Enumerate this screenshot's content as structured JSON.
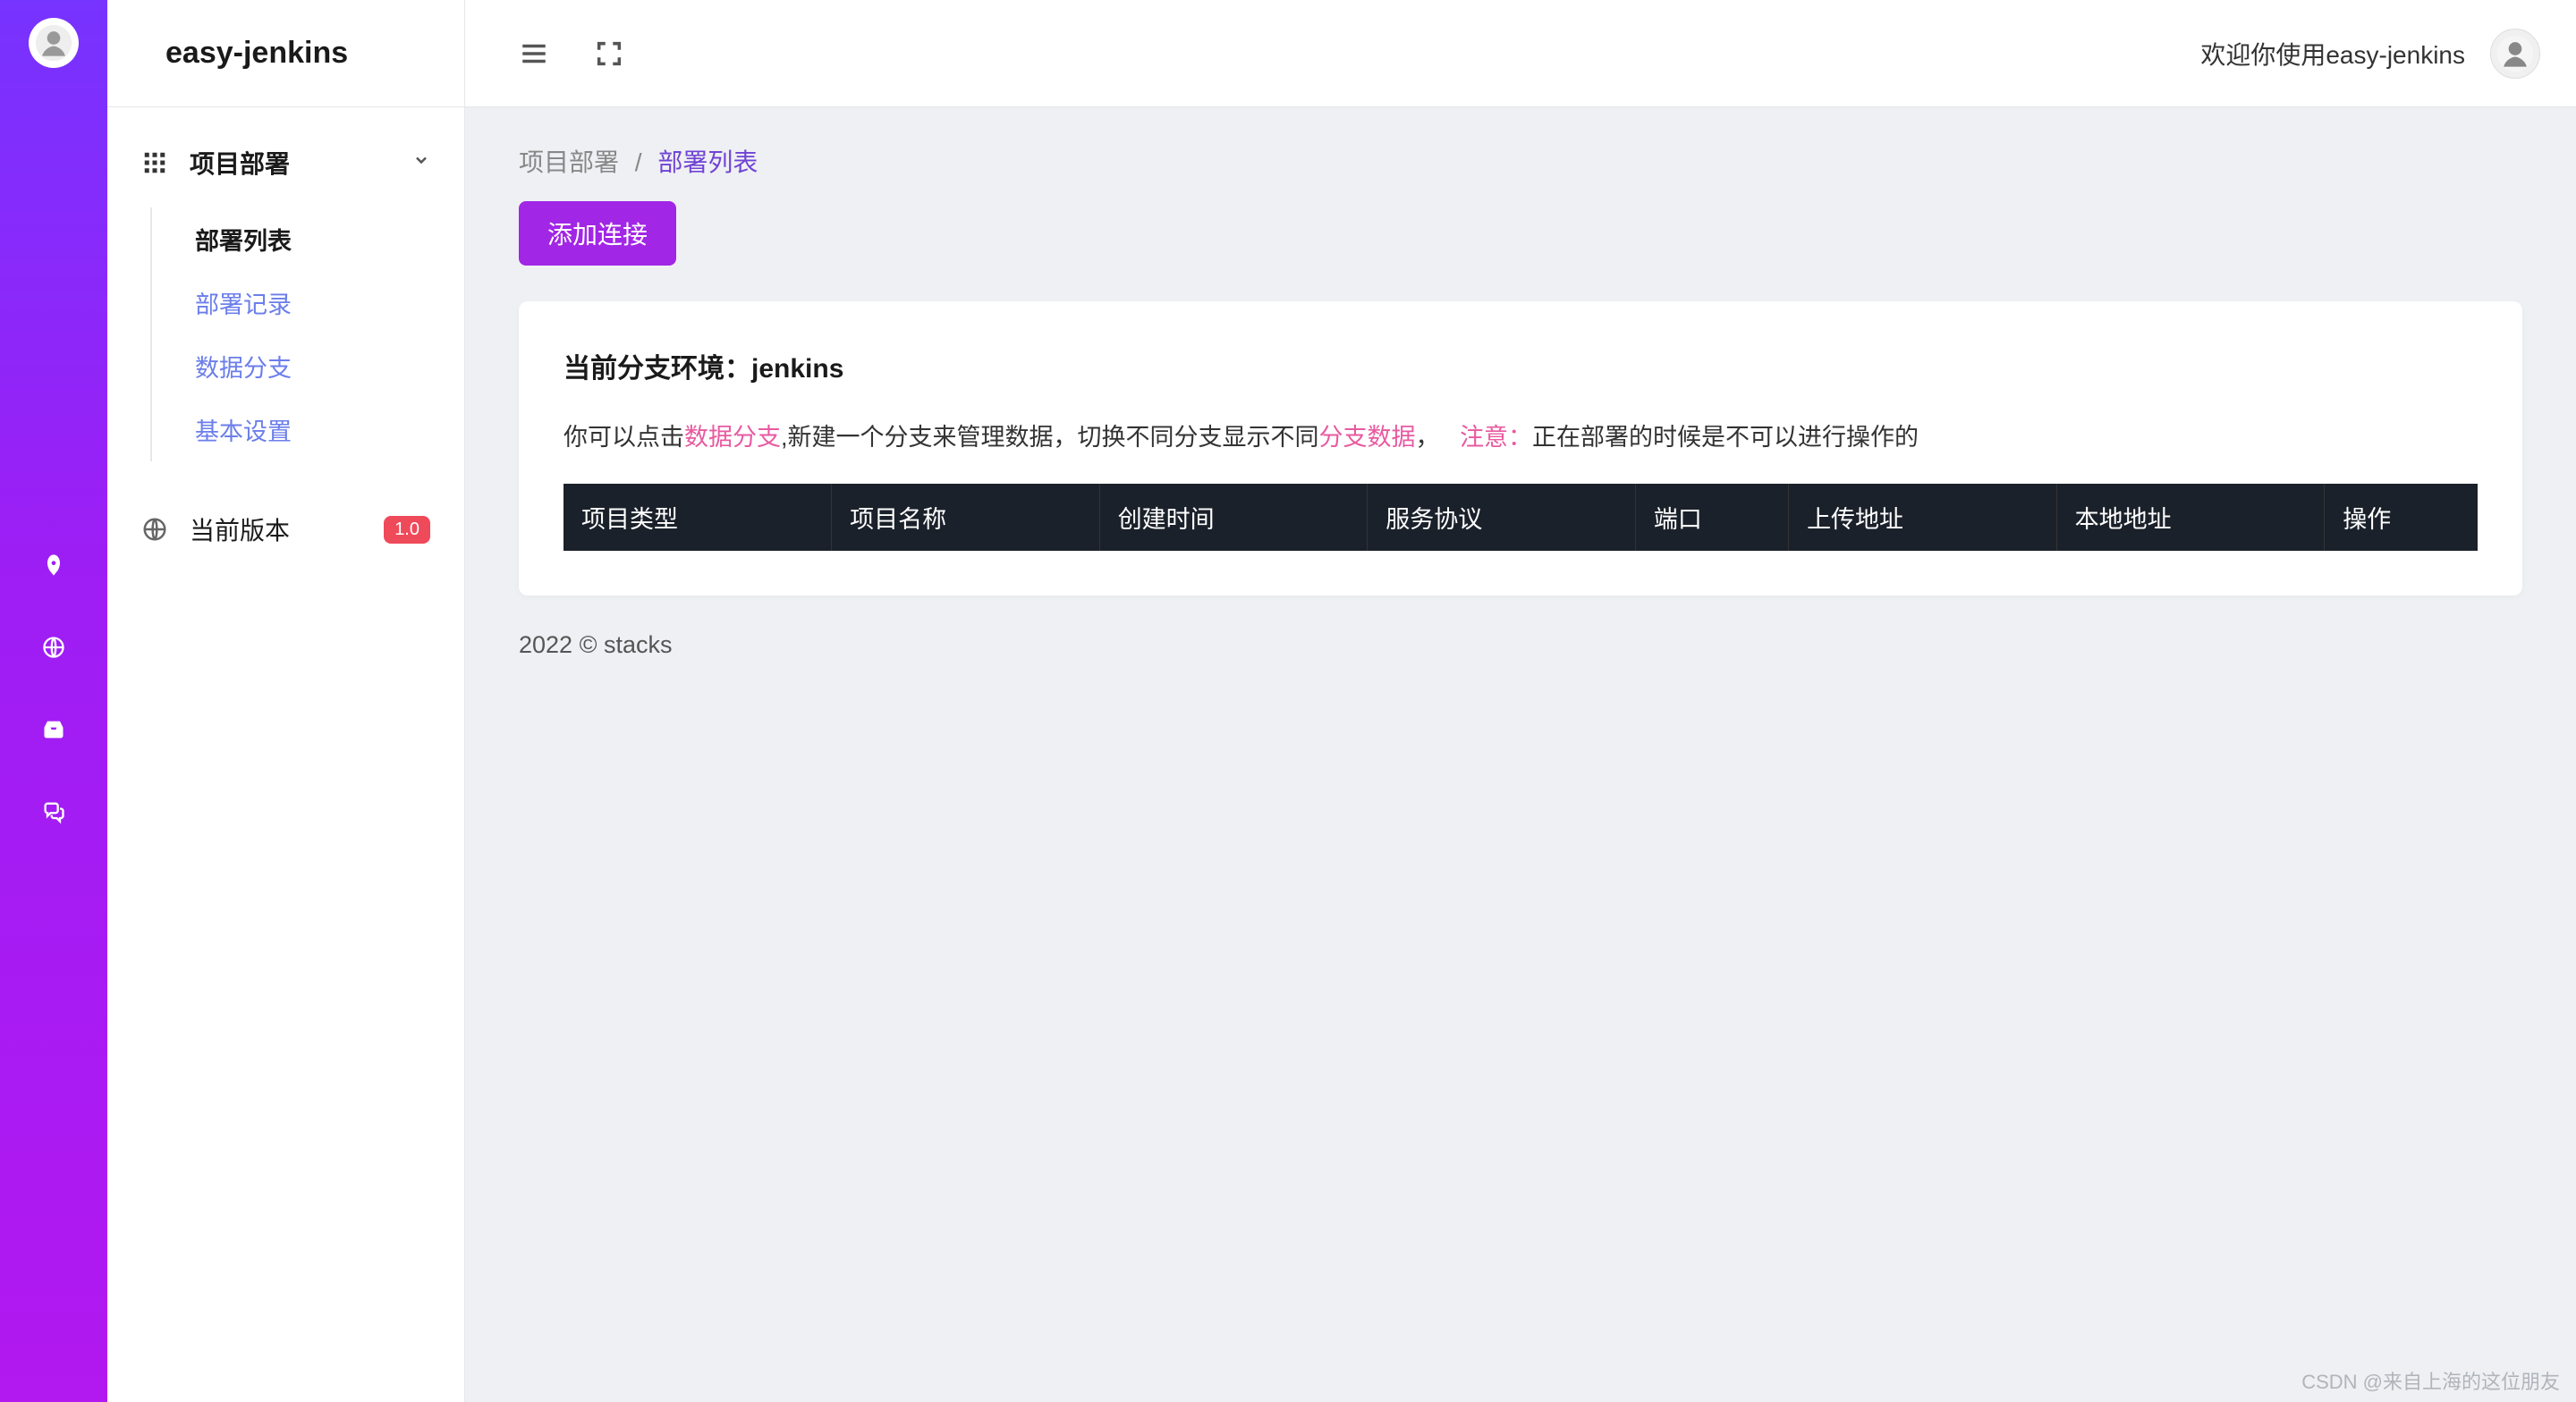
{
  "brand": "easy-jenkins",
  "sidebar": {
    "main": {
      "label": "项目部署"
    },
    "items": [
      {
        "label": "部署列表",
        "active": true
      },
      {
        "label": "部署记录",
        "active": false
      },
      {
        "label": "数据分支",
        "active": false
      },
      {
        "label": "基本设置",
        "active": false
      }
    ],
    "version": {
      "label": "当前版本",
      "badge": "1.0"
    }
  },
  "topbar": {
    "welcome": "欢迎你使用easy-jenkins"
  },
  "breadcrumb": {
    "parent": "项目部署",
    "sep": "/",
    "current": "部署列表"
  },
  "actions": {
    "add_label": "添加连接"
  },
  "panel": {
    "env_title": "当前分支环境：jenkins",
    "hint_prefix": "你可以点击",
    "hint_link1": "数据分支",
    "hint_mid": ",新建一个分支来管理数据，切换不同分支显示不同",
    "hint_link2": "分支数据",
    "hint_comma": "，",
    "hint_warn_label": "注意：",
    "hint_warn_text": "正在部署的时候是不可以进行操作的"
  },
  "table": {
    "columns": [
      "项目类型",
      "项目名称",
      "创建时间",
      "服务协议",
      "端口",
      "上传地址",
      "本地地址",
      "操作"
    ],
    "rows": []
  },
  "footer": "2022 © stacks",
  "watermark": "CSDN @来自上海的这位朋友"
}
